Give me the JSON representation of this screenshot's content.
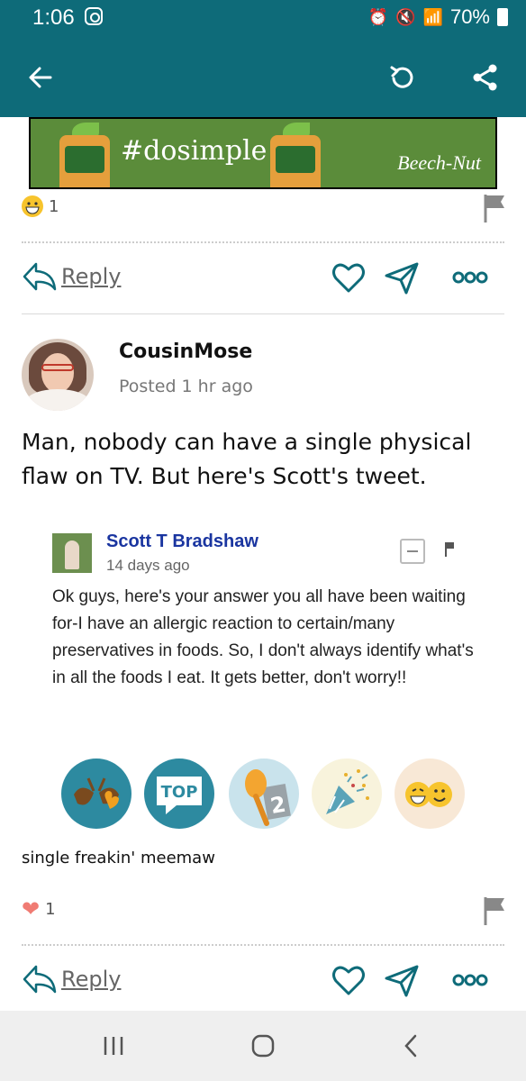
{
  "status_bar": {
    "time": "1:06",
    "battery": "70%"
  },
  "ad": {
    "tagline": "#dosimple",
    "brand": "Beech-Nut"
  },
  "prev_post": {
    "reaction_count": "1"
  },
  "actions": {
    "reply_label": "Reply"
  },
  "post": {
    "username": "CousinMose",
    "posted": "Posted 1 hr ago",
    "text": "Man, nobody can have a single physical flaw on TV. But here's Scott's tweet.",
    "embed": {
      "author": "Scott T Bradshaw",
      "date": "14 days ago",
      "body": "Ok guys, here's your answer you all have been waiting for-I have an allergic reaction to certain/many preservatives in foods. So, I don't always identify what's in all the foods I eat. It gets better, don't worry!!"
    },
    "badges": [
      {
        "name": "bra-heart-badge"
      },
      {
        "name": "top-badge",
        "label": "TOP"
      },
      {
        "name": "second-place-badge",
        "label": "2"
      },
      {
        "name": "party-popper-badge"
      },
      {
        "name": "laughing-faces-badge"
      }
    ],
    "caption": "single freakin' meemaw",
    "reaction_count": "1"
  },
  "colors": {
    "teal": "#0e6b79",
    "heart": "#f07b73"
  }
}
